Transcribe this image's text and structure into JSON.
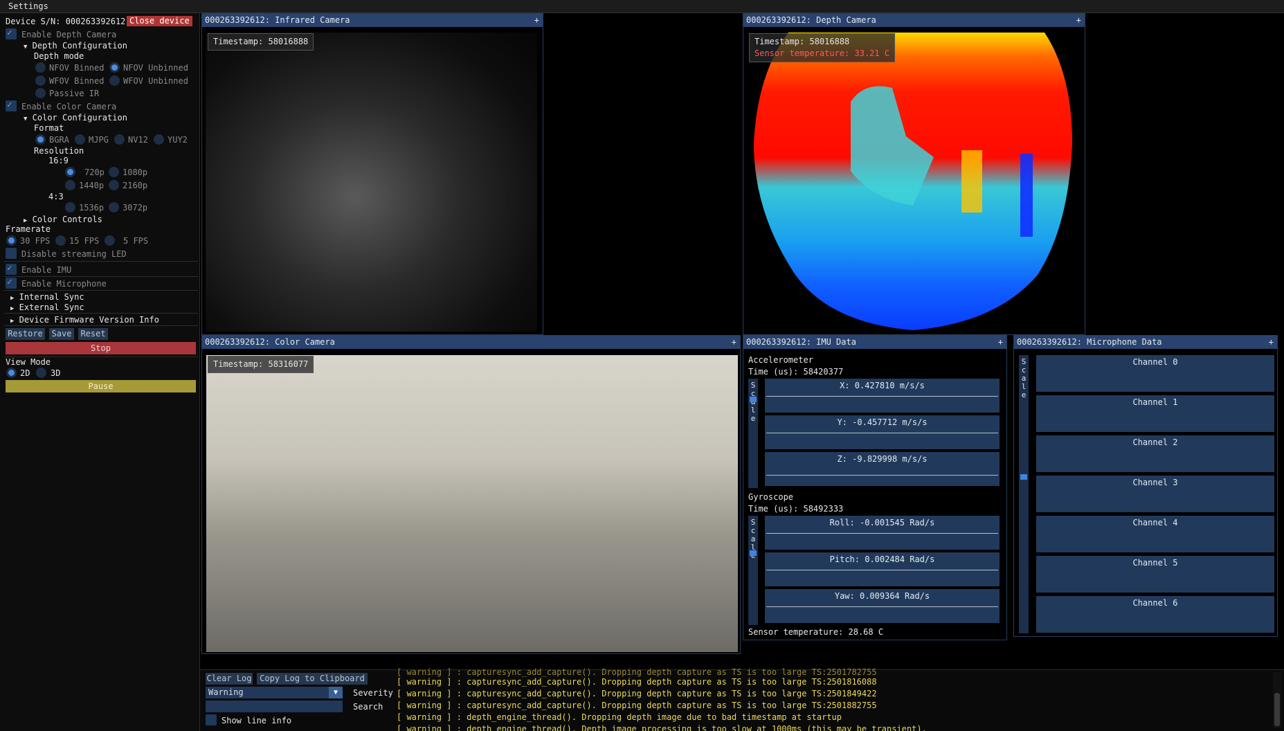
{
  "menubar": {
    "settings": "Settings"
  },
  "sidebar": {
    "device_sn_label": "Device S/N: 000263392612",
    "close_device": "Close device",
    "enable_depth": "Enable Depth Camera",
    "depth_config": "Depth Configuration",
    "depth_mode": "Depth mode",
    "depth_modes": [
      "NFOV Binned",
      "NFOV Unbinned",
      "WFOV Binned",
      "WFOV Unbinned",
      "Passive IR"
    ],
    "enable_color": "Enable Color Camera",
    "color_config": "Color Configuration",
    "format": "Format",
    "formats": [
      "BGRA",
      "MJPG",
      "NV12",
      "YUY2"
    ],
    "resolution": "Resolution",
    "ratio_169": "16:9",
    "res_169": [
      "720p",
      "1080p",
      "1440p",
      "2160p"
    ],
    "ratio_43": "4:3",
    "res_43": [
      "1536p",
      "3072p"
    ],
    "color_controls": "Color Controls",
    "framerate": "Framerate",
    "fps": [
      "30 FPS",
      "15 FPS",
      "5 FPS"
    ],
    "disable_led": "Disable streaming LED",
    "enable_imu": "Enable IMU",
    "enable_mic": "Enable Microphone",
    "internal_sync": "Internal Sync",
    "external_sync": "External Sync",
    "firmware_info": "Device Firmware Version Info",
    "restore": "Restore",
    "save": "Save",
    "reset": "Reset",
    "stop": "Stop",
    "view_mode": "View Mode",
    "view_2d": "2D",
    "view_3d": "3D",
    "pause": "Pause"
  },
  "infrared": {
    "title": "000263392612: Infrared Camera",
    "timestamp": "Timestamp: 58016888"
  },
  "depth": {
    "title": "000263392612: Depth Camera",
    "timestamp": "Timestamp: 58016888",
    "sensor_temp": "Sensor temperature: 33.21 C"
  },
  "color": {
    "title": "000263392612: Color Camera",
    "timestamp": "Timestamp: 58316077"
  },
  "imu": {
    "title": "000263392612: IMU Data",
    "accel_label": "Accelerometer",
    "accel_time": "Time (us): 58420377",
    "accel": [
      "X:    0.427810 m/s/s",
      "Y:   -0.457712 m/s/s",
      "Z:   -9.829998 m/s/s"
    ],
    "gyro_label": "Gyroscope",
    "gyro_time": "Time (us): 58492333",
    "gyro": [
      "Roll:   -0.001545 Rad/s",
      "Pitch:    0.002484 Rad/s",
      "Yaw:    0.009364 Rad/s"
    ],
    "sensor_temp": "Sensor temperature: 28.68 C",
    "scale_word": "Scale"
  },
  "mic": {
    "title": "000263392612: Microphone Data",
    "channels": [
      "Channel 0",
      "Channel 1",
      "Channel 2",
      "Channel 3",
      "Channel 4",
      "Channel 5",
      "Channel 6"
    ]
  },
  "log": {
    "clear_log": "Clear Log",
    "copy_log": "Copy Log to Clipboard",
    "severity_value": "Warning",
    "severity_label": "Severity",
    "search_label": "Search",
    "show_line_info": "Show line info",
    "lines": [
      "[ warning  ] : capturesync_add_capture(). Dropping depth capture as TS is too large TS:2501816088",
      "[ warning  ] : capturesync_add_capture(). Dropping depth capture as TS is too large TS:2501849422",
      "[ warning  ] : capturesync_add_capture(). Dropping depth capture as TS is too large TS:2501882755",
      "[ warning  ] : depth_engine_thread(). Dropping depth image due to bad timestamp at startup",
      "[ warning  ] : depth_engine_thread(). Depth image processing is too slow at 1000ms (this may be transient)."
    ]
  },
  "colors": {
    "title_bar": "#29436e",
    "stop": "#a8363a",
    "pause": "#a69a36",
    "close_device": "#b03535",
    "log_text": "#ebd85a"
  }
}
